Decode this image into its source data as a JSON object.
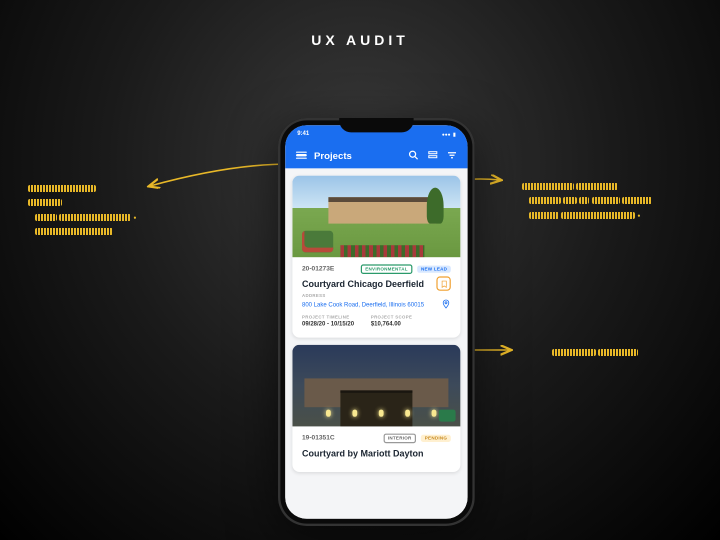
{
  "slide": {
    "title": "UX AUDIT"
  },
  "status": {
    "time": "9:41"
  },
  "nav": {
    "title": "Projects"
  },
  "cards": [
    {
      "id": "20-01273E",
      "tags": [
        "ENVIRONMENTAL",
        "NEW LEAD"
      ],
      "name": "Courtyard Chicago Deerfield",
      "address_label": "ADDRESS",
      "address": "800 Lake Cook Road, Deerfield, Illinois 60015",
      "timeline_label": "PROJECT TIMELINE",
      "timeline": "09/28/20 - 10/15/20",
      "scope_label": "PROJECT SCOPE",
      "scope": "$10,764.00"
    },
    {
      "id": "19-01351C",
      "tags": [
        "INTERIOR",
        "PENDING"
      ],
      "name": "Courtyard by Mariott Dayton"
    }
  ],
  "annotations": {
    "left": "handwritten note about navigation",
    "top_right": "handwritten note about card layout and imagery",
    "right": "handwritten note"
  }
}
